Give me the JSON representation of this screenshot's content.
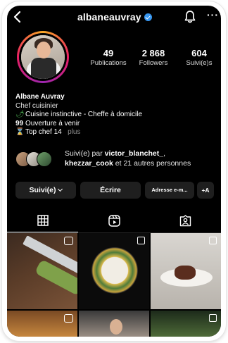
{
  "profile": {
    "username": "albaneauvray",
    "verified": true,
    "stats": [
      {
        "value": "49",
        "label": "Publications"
      },
      {
        "value": "2 868",
        "label": "Followers"
      },
      {
        "value": "604",
        "label": "Suivi(e)s"
      }
    ],
    "display_name": "Albane Auvray",
    "category": "Chef cuisinier",
    "bio_lines": [
      {
        "emoji": "🌶",
        "text": "Cuisine instinctive - Cheffe à domicile"
      },
      {
        "emoji": "99",
        "text": "Ouverture à venir"
      },
      {
        "emoji": "⌛",
        "text": "Top chef 14"
      }
    ],
    "more_label": "plus"
  },
  "followed_by": {
    "prefix": "Suivi(e) par ",
    "user1": "victor_blanchet_",
    "sep": ",",
    "user2": "khezzar_cook",
    "suffix": " et 21 autres personnes"
  },
  "actions": {
    "following_label": "Suivi(e)",
    "message_label": "Écrire",
    "email_label": "Adresse e-m...",
    "add_person_label": "+A"
  },
  "tabs": [
    "grid",
    "reels",
    "tagged"
  ],
  "colors": {
    "background": "#000000",
    "verified": "#3897f0",
    "button": "#1f1f1f",
    "secondary_text": "#8e8e8e"
  }
}
